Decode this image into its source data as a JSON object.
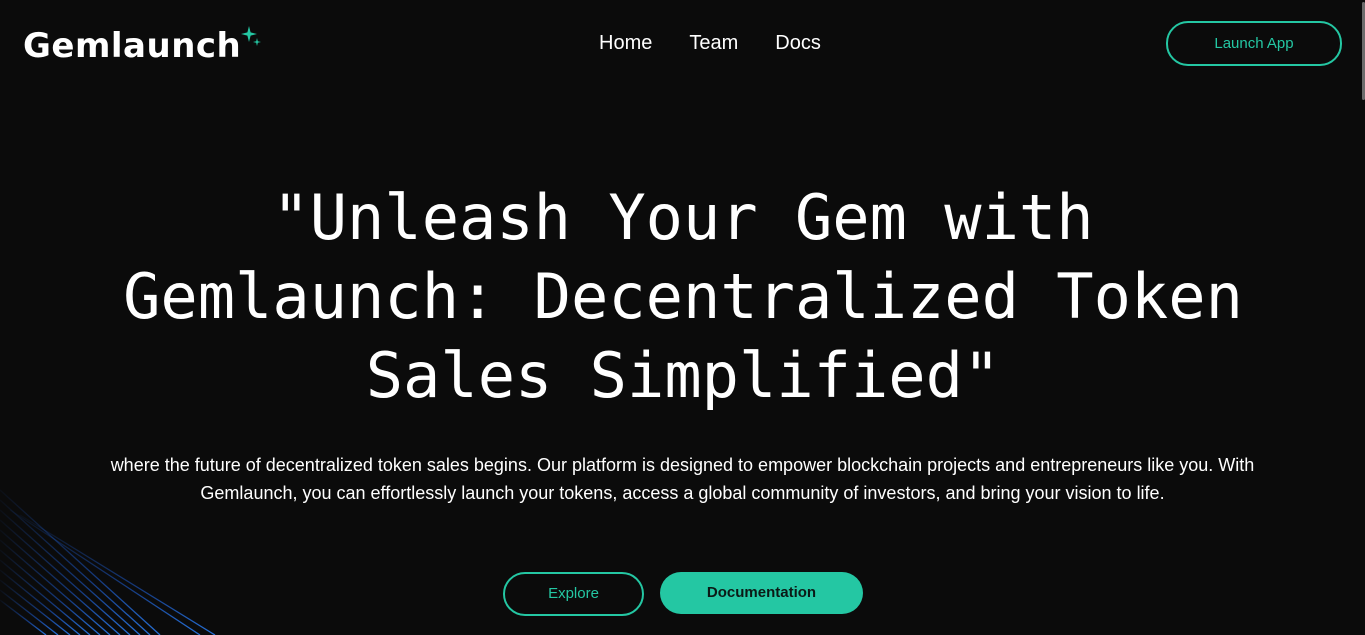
{
  "header": {
    "logo_text": "Gemlaunch",
    "nav": [
      {
        "label": "Home"
      },
      {
        "label": "Team"
      },
      {
        "label": "Docs"
      }
    ],
    "launch_button": "Launch App"
  },
  "hero": {
    "title": "\"Unleash Your Gem with Gemlaunch: Decentralized Token Sales Simplified\"",
    "description": "where the future of decentralized token sales begins. Our platform is designed to empower blockchain projects and entrepreneurs like you. With Gemlaunch, you can effortlessly launch your tokens, access a global community of investors, and bring your vision to life.",
    "explore_button": "Explore",
    "documentation_button": "Documentation"
  },
  "colors": {
    "background": "#0b0b0b",
    "accent": "#24c7a3",
    "text": "#ffffff",
    "deco_lines": "#1e5fd8"
  },
  "icons": {
    "logo_mark": "sparkle-icon"
  }
}
